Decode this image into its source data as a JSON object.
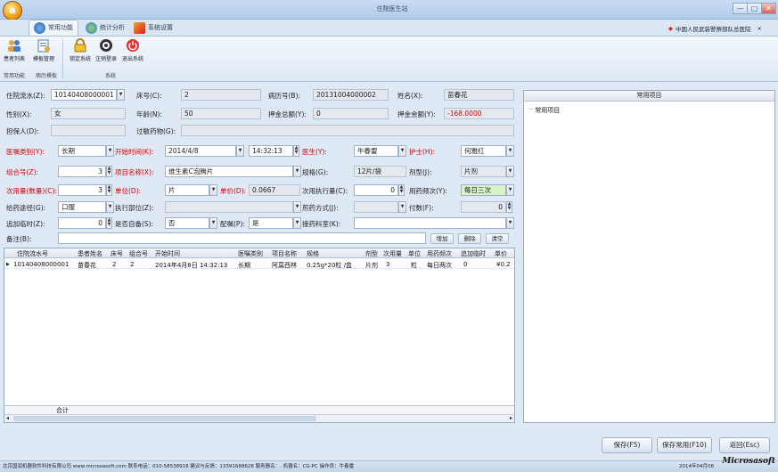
{
  "window": {
    "title": "住院医生站",
    "min": "—",
    "max": "▢",
    "close": "✕",
    "app_orb": "a"
  },
  "ribbon": {
    "tabs": [
      {
        "label": "常用功能"
      },
      {
        "label": "统计分析"
      },
      {
        "label": "系统设置"
      }
    ],
    "org_name": "中国人民武装警察部队总医院",
    "org_close": "×",
    "buttons": [
      {
        "label": "患者列表"
      },
      {
        "label": "模板管理"
      },
      {
        "label": "锁定系统"
      },
      {
        "label": "注销登录"
      },
      {
        "label": "退出系统"
      }
    ],
    "groups": [
      "常用功能",
      "病历模板",
      "系统"
    ]
  },
  "form": {
    "inpatient_no_label": "住院流水(Z):",
    "inpatient_no": "10140408000001",
    "bed_label": "床号(C):",
    "bed": "2",
    "record_no_label": "病历号(B):",
    "record_no": "20131004000002",
    "name_label": "姓名(X):",
    "name": "苗春花",
    "gender_label": "性别(X):",
    "gender": "女",
    "age_label": "年龄(N):",
    "age": "50",
    "deposit_label": "押金总额(Y):",
    "deposit": "0",
    "balance_label": "押金余额(Y):",
    "balance": "-168.0000",
    "guarantor_label": "担保人(D):",
    "guarantor": "",
    "allergy_label": "过敏药物(G):",
    "allergy": "",
    "order_type_label": "医嘱类别(Y):",
    "order_type": "长期",
    "start_time_label": "开始时间(K):",
    "start_date": "2014/4/8",
    "start_time": "14:32:13",
    "doctor_label": "医生(Y):",
    "doctor": "牛春雷",
    "nurse_label": "护士(H):",
    "nurse": "何雅红",
    "group_no_label": "组合号(Z):",
    "group_no": "3",
    "item_name_label": "项目名称(X):",
    "item_name": "维生素C泡腾片",
    "spec_label": "规格(G):",
    "spec": "12片/袋",
    "form_type_label": "剂型(J):",
    "form_type": "片剂",
    "dose_label": "次用量(数量)(C):",
    "dose": "3",
    "unit_label": "单位(D):",
    "unit": "片",
    "price_label": "单价(D):",
    "price": "0.0667",
    "exec_amount_label": "次用执行量(C):",
    "exec_amount": "0",
    "frequency_label": "用药频次(Y):",
    "frequency": "每日三次",
    "route_label": "给药途径(G):",
    "route": "口服",
    "exec_dept_label": "执行部位(Z):",
    "exec_dept": "",
    "decoct_label": "煎药方式(J):",
    "decoct": "",
    "doses_label": "付数(F):",
    "doses": "0",
    "add_time_label": "追加临时(Z):",
    "add_time": "0",
    "self_prepared_label": "是否自备(S):",
    "self_prepared": "否",
    "dispense_label": "配嘱(P):",
    "dispense": "是",
    "dept_label": "接药科室(K):",
    "dept": "",
    "remark_label": "备注(B):",
    "remark": "",
    "add_btn": "增加",
    "delete_btn": "删除",
    "clear_btn": "清空"
  },
  "grid": {
    "headers": [
      "住院流水号",
      "患者姓名",
      "床号",
      "组合号",
      "开始时间",
      "医嘱类别",
      "项目名称",
      "规格",
      "剂型",
      "次用量",
      "单位",
      "用药频次",
      "追加临时",
      "单价"
    ],
    "rows": [
      [
        "10140408000001",
        "苗春花",
        "2",
        "2",
        "2014年4月8日 14:32:13",
        "长期",
        "阿莫西林",
        "0.25g*20粒 /盒",
        "片剂",
        "3",
        "粒",
        "每日两次",
        "0",
        "¥0.2"
      ]
    ],
    "footer_label": "合计"
  },
  "right_panel": {
    "title": "常用项目",
    "tree_item": "常用项目"
  },
  "buttons": {
    "save": "保存(F5)",
    "save_common": "保存常用(F10)",
    "back": "返回(Esc)"
  },
  "status": {
    "text": "北京国润机器软件科技有限公司  www.microsasoft.com  联系电话：010-58538918  建议与反馈：13391688628  服务器名：.  机器名：CG-PC  操作员：牛春雷",
    "datetime": "2014年04月08",
    "logo": "Microsasoft"
  },
  "colors": {
    "required_label": "#d10000",
    "balance": "#d10000",
    "frequency_bg": "#d8f3c8",
    "accent": "#2a5db0"
  }
}
